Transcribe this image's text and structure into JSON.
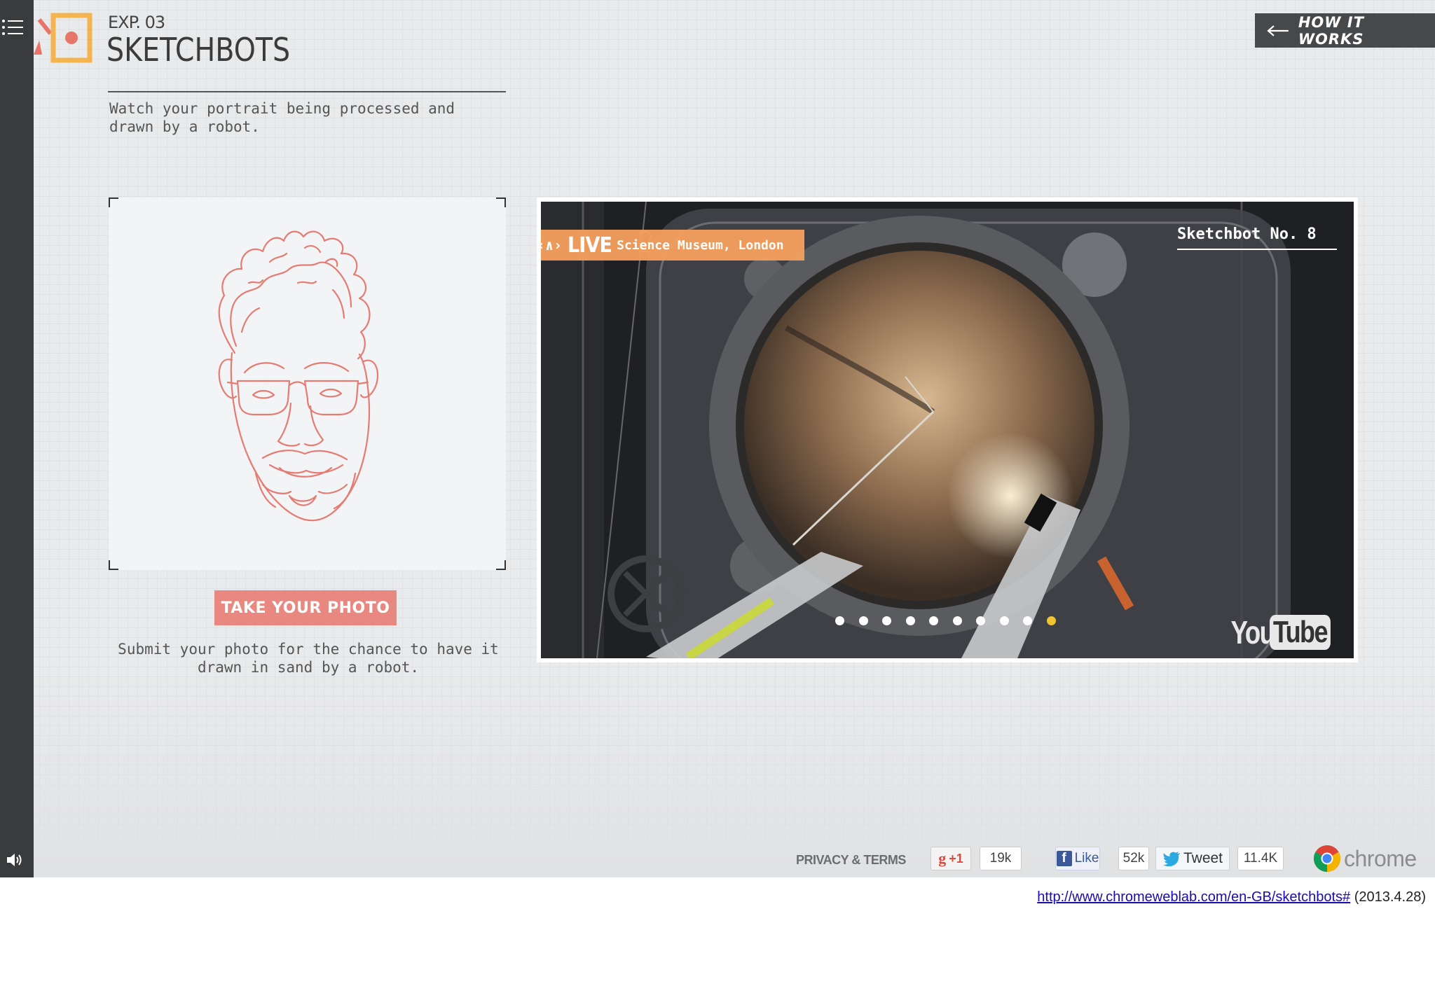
{
  "header": {
    "exp_label": "EXP. 03",
    "title": "SKETCHBOTS",
    "intro": "Watch your portrait being processed and drawn by a robot.",
    "how_button": "HOW IT WORKS"
  },
  "portrait": {
    "take_photo_label": "TAKE YOUR PHOTO",
    "submit_text": "Submit your photo for the chance to have it drawn in sand by a robot."
  },
  "video": {
    "live_icon": "‹∧›",
    "live_word": "LIVE",
    "location": "Science Museum, London",
    "bot_name": "Sketchbot No. 8",
    "slide_count": 10,
    "active_slide": 10,
    "youtube_you": "You",
    "youtube_tube": "Tube"
  },
  "footer": {
    "privacy": "PRIVACY & TERMS",
    "gplus_label": "+1",
    "gplus_count": "19k",
    "fb_label": "Like",
    "fb_count": "52k",
    "tweet_label": "Tweet",
    "tweet_count": "11.4K",
    "chrome_word": "chrome"
  },
  "caption": {
    "url": "http://www.chromeweblab.com/en-GB/sketchbots#",
    "date": "(2013.4.28)"
  },
  "colors": {
    "accent_orange": "#f5a05f",
    "button_pink": "#e98881",
    "portrait_line": "#e57b73",
    "active_dot": "#f1c232",
    "rail": "#3a3b3d"
  },
  "icons": [
    "menu-icon",
    "sound-icon",
    "logo-icon",
    "arrow-left-icon",
    "live-icon",
    "youtube-logo",
    "google-plus-icon",
    "facebook-icon",
    "twitter-bird-icon",
    "chrome-icon"
  ]
}
